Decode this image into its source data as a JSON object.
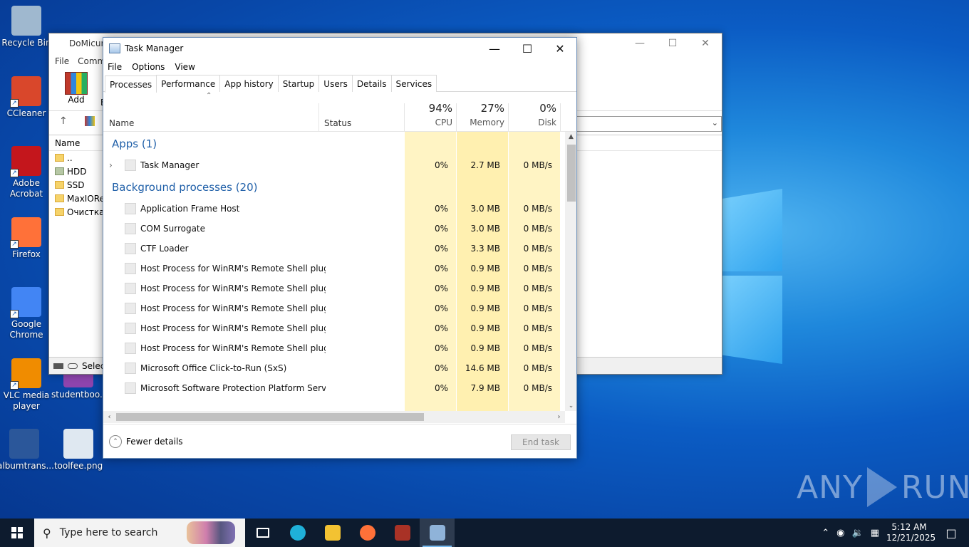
{
  "desktop": {
    "icons": [
      {
        "label": "Recycle Bin",
        "icon": "recycle-bin-icon",
        "color": "#9fb8cf"
      },
      {
        "label": "CCleaner",
        "icon": "ccleaner-icon",
        "color": "#d9472b"
      },
      {
        "label": "Adobe Acrobat",
        "icon": "acrobat-icon",
        "color": "#c4161c"
      },
      {
        "label": "Firefox",
        "icon": "firefox-icon",
        "color": "#ff7139"
      },
      {
        "label": "Google Chrome",
        "icon": "chrome-icon",
        "color": "#4285f4"
      },
      {
        "label": "VLC media player",
        "icon": "vlc-icon",
        "color": "#f08c00"
      },
      {
        "label": "albumtrans...",
        "icon": "word-doc-icon",
        "color": "#2b579a"
      },
      {
        "label": "studentboo...",
        "icon": "winrar-archive-icon",
        "color": "#8e44ad"
      },
      {
        "label": "toolfee.png",
        "icon": "image-file-icon",
        "color": "#dfe8f1"
      }
    ]
  },
  "winrar": {
    "title": "DoMicur",
    "menu": [
      "File",
      "Comm"
    ],
    "toolbar": [
      {
        "label": "Add"
      },
      {
        "label": "E"
      }
    ],
    "list_header": "Name",
    "rows": [
      {
        "name": ".."
      },
      {
        "name": "HDD"
      },
      {
        "name": "SSD"
      },
      {
        "name": "MaxIORec"
      },
      {
        "name": "Очистка"
      }
    ],
    "status": "Select"
  },
  "taskmgr": {
    "title": "Task Manager",
    "menu": [
      "File",
      "Options",
      "View"
    ],
    "tabs": [
      "Processes",
      "Performance",
      "App history",
      "Startup",
      "Users",
      "Details",
      "Services"
    ],
    "active_tab": "Processes",
    "columns": {
      "name": "Name",
      "status": "Status",
      "cpu": {
        "pct": "94%",
        "label": "CPU"
      },
      "memory": {
        "pct": "27%",
        "label": "Memory"
      },
      "disk": {
        "pct": "0%",
        "label": "Disk"
      }
    },
    "groups": {
      "apps": "Apps (1)",
      "background": "Background processes (20)"
    },
    "apps": [
      {
        "name": "Task Manager",
        "cpu": "0%",
        "memory": "2.7 MB",
        "disk": "0 MB/s"
      }
    ],
    "background": [
      {
        "name": "Application Frame Host",
        "cpu": "0%",
        "memory": "3.0 MB",
        "disk": "0 MB/s"
      },
      {
        "name": "COM Surrogate",
        "cpu": "0%",
        "memory": "3.0 MB",
        "disk": "0 MB/s"
      },
      {
        "name": "CTF Loader",
        "cpu": "0%",
        "memory": "3.3 MB",
        "disk": "0 MB/s"
      },
      {
        "name": "Host Process for WinRM's Remote Shell plugin",
        "cpu": "0%",
        "memory": "0.9 MB",
        "disk": "0 MB/s"
      },
      {
        "name": "Host Process for WinRM's Remote Shell plugin",
        "cpu": "0%",
        "memory": "0.9 MB",
        "disk": "0 MB/s"
      },
      {
        "name": "Host Process for WinRM's Remote Shell plugin",
        "cpu": "0%",
        "memory": "0.9 MB",
        "disk": "0 MB/s"
      },
      {
        "name": "Host Process for WinRM's Remote Shell plugin",
        "cpu": "0%",
        "memory": "0.9 MB",
        "disk": "0 MB/s"
      },
      {
        "name": "Host Process for WinRM's Remote Shell plugin",
        "cpu": "0%",
        "memory": "0.9 MB",
        "disk": "0 MB/s"
      },
      {
        "name": "Microsoft Office Click-to-Run (SxS)",
        "cpu": "0%",
        "memory": "14.6 MB",
        "disk": "0 MB/s"
      },
      {
        "name": "Microsoft Software Protection Platform Servi...",
        "cpu": "0%",
        "memory": "7.9 MB",
        "disk": "0 MB/s"
      }
    ],
    "footer": {
      "fewer_details": "Fewer details",
      "end_task": "End task"
    },
    "colors": {
      "cpu_heat": "#fff4c4",
      "mem_heat": "#fff0b0",
      "disk_heat": "#fff4c4",
      "group_text": "#1f5fa8"
    }
  },
  "watermark": {
    "left": "ANY",
    "right": "RUN"
  },
  "taskbar": {
    "search_placeholder": "Type here to search",
    "apps": [
      {
        "icon": "task-view-icon",
        "color": "#ffffff"
      },
      {
        "icon": "edge-icon",
        "color": "#1fb0d9"
      },
      {
        "icon": "file-explorer-icon",
        "color": "#f3c232"
      },
      {
        "icon": "firefox-icon",
        "color": "#ff7139"
      },
      {
        "icon": "winrar-icon",
        "color": "#a93226"
      },
      {
        "icon": "task-manager-icon",
        "color": "#8fb3d9"
      }
    ],
    "time": "5:12 AM",
    "date": "12/21/2025"
  }
}
